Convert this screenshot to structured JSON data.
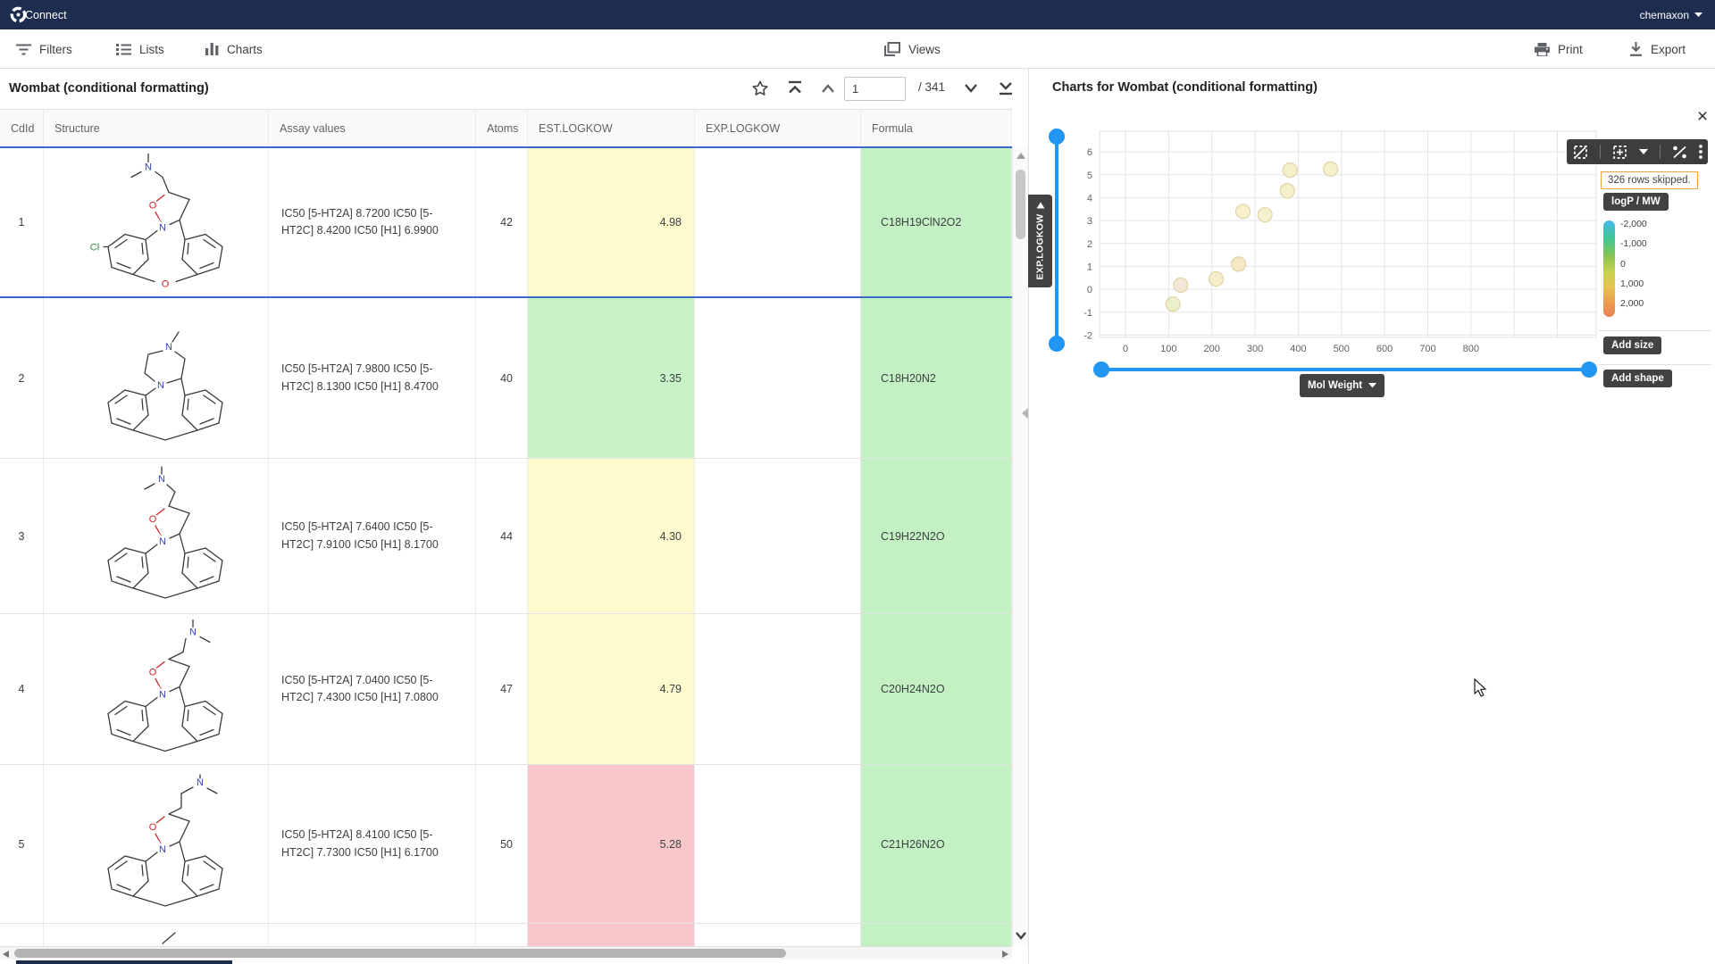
{
  "navbar": {
    "brand": "Connect",
    "user": "chemaxon"
  },
  "toolbar": {
    "filters": "Filters",
    "lists": "Lists",
    "charts": "Charts",
    "views": "Views",
    "print": "Print",
    "export": "Export"
  },
  "grid": {
    "title": "Wombat (conditional formatting)",
    "pagination": {
      "current_page": "1",
      "total": "/ 341"
    },
    "columns": [
      "CdId",
      "Structure",
      "Assay values",
      "Atoms",
      "EST.LOGKOW",
      "EXP.LOGKOW",
      "Formula"
    ],
    "cell_colors": {
      "yellow": "#fdfbce",
      "green": "#c9f4c8",
      "pink": "#f9c7c9",
      "formula_green": "#c4f1c3",
      "selection_blue": "#3b69c9"
    },
    "rows": [
      {
        "cdid": "1",
        "assay": "IC50 [5-HT2A] 8.7200 IC50 [5-HT2C] 8.4200 IC50 [H1] 6.9900",
        "atoms": "42",
        "est_logkow": "4.98",
        "est_color": "#fdfbce",
        "exp_logkow": "",
        "formula": "C18H19ClN2O2",
        "selected": true
      },
      {
        "cdid": "2",
        "assay": "IC50 [5-HT2A] 7.9800 IC50 [5-HT2C] 8.1300 IC50 [H1] 8.4700",
        "atoms": "40",
        "est_logkow": "3.35",
        "est_color": "#c9f4c8",
        "exp_logkow": "",
        "formula": "C18H20N2",
        "selected": false
      },
      {
        "cdid": "3",
        "assay": "IC50 [5-HT2A] 7.6400 IC50 [5-HT2C] 7.9100 IC50 [H1] 8.1700",
        "atoms": "44",
        "est_logkow": "4.30",
        "est_color": "#fdfbce",
        "exp_logkow": "",
        "formula": "C19H22N2O",
        "selected": false
      },
      {
        "cdid": "4",
        "assay": "IC50 [5-HT2A] 7.0400 IC50 [5-HT2C] 7.4300 IC50 [H1] 7.0800",
        "atoms": "47",
        "est_logkow": "4.79",
        "est_color": "#fdfbce",
        "exp_logkow": "",
        "formula": "C20H24N2O",
        "selected": false
      },
      {
        "cdid": "5",
        "assay": "IC50 [5-HT2A] 8.4100 IC50 [5-HT2C] 7.7300 IC50 [H1] 6.1700",
        "atoms": "50",
        "est_logkow": "5.28",
        "est_color": "#f9c7c9",
        "exp_logkow": "",
        "formula": "C21H26N2O",
        "selected": false
      }
    ],
    "partial_row6_est_color": "#f9c7c9"
  },
  "charts_panel": {
    "title": "Charts for Wombat (conditional formatting)",
    "close_label": "×",
    "y_axis_tab": "EXP.LOGKOW",
    "x_axis_button": "Mol Weight",
    "add_size": "Add size",
    "add_shape": "Add shape"
  },
  "chart_data": {
    "type": "scatter",
    "title": "",
    "xlabel": "Mol Weight",
    "ylabel": "EXP.LOGKOW",
    "xlim": [
      -60,
      1090
    ],
    "ylim": [
      -2.1,
      6.9
    ],
    "x_ticks": [
      0,
      100,
      200,
      300,
      400,
      500,
      600,
      700,
      800
    ],
    "x_grid_extra": [
      900,
      1000
    ],
    "y_ticks": [
      -2,
      -1,
      0,
      1,
      2,
      3,
      4,
      5,
      6
    ],
    "grid": true,
    "point_radius": 8,
    "points": [
      {
        "x": 110,
        "y": -0.65,
        "color": "#e9efc6"
      },
      {
        "x": 128,
        "y": 0.18,
        "color": "#f4e6d6"
      },
      {
        "x": 210,
        "y": 0.45,
        "color": "#f6edc8"
      },
      {
        "x": 262,
        "y": 1.1,
        "color": "#f7e8c2"
      },
      {
        "x": 272,
        "y": 3.4,
        "color": "#f6efca"
      },
      {
        "x": 323,
        "y": 3.25,
        "color": "#f6efca"
      },
      {
        "x": 375,
        "y": 4.3,
        "color": "#f6eec8"
      },
      {
        "x": 381,
        "y": 5.2,
        "color": "#f6eec8"
      },
      {
        "x": 475,
        "y": 5.25,
        "color": "#f6eec8"
      }
    ],
    "color_scale": {
      "label": "logP / MW",
      "note": "326 rows skipped.",
      "ticks": [
        "-2,000",
        "-1,000",
        "0",
        "1,000",
        "2,000"
      ],
      "gradient": [
        "#45b8ee",
        "#3fc796",
        "#8bc54d",
        "#c8d24c",
        "#e7c44d",
        "#eb9f4e",
        "#ea7f50"
      ]
    },
    "legend_position": "right"
  }
}
